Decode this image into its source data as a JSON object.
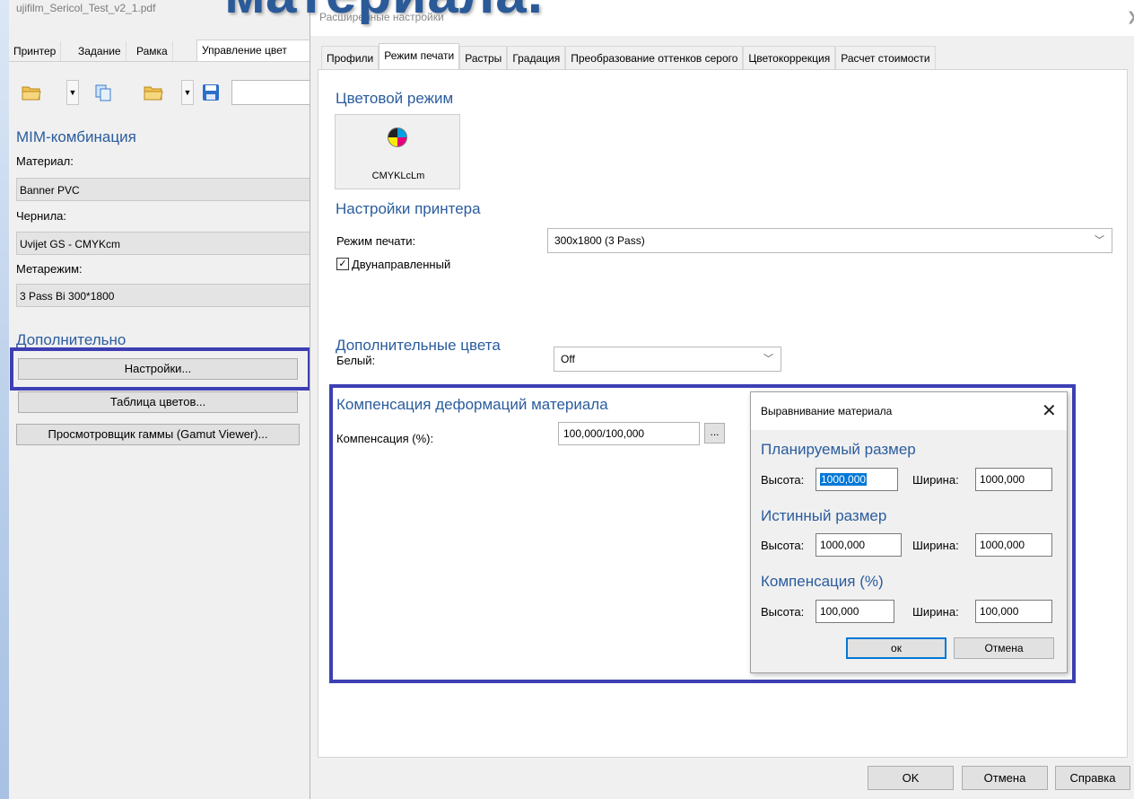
{
  "slide": {
    "heading": "материала."
  },
  "left_panel": {
    "file_title": "ujifilm_Sericol_Test_v2_1.pdf",
    "tabs": [
      "Принтер",
      "Задание",
      "Рамка",
      "Управление цвет"
    ],
    "active_tab_index": 3,
    "mim_heading": "MIM-комбинация",
    "material_label": "Материал:",
    "material_value": "Banner PVC",
    "ink_label": "Чернила:",
    "ink_value": "Uvijet GS - CMYKcm",
    "metamode_label": "Метарежим:",
    "metamode_value": "3 Pass Bi 300*1800",
    "additional_heading": "Дополнительно",
    "settings_button": "Настройки...",
    "color_table_button": "Таблица цветов...",
    "gamut_viewer_button": "Просмотровщик гаммы (Gamut Viewer)..."
  },
  "dialog": {
    "title": "Расширенные настройки",
    "tabs": [
      "Профили",
      "Режим печати",
      "Растры",
      "Градация",
      "Преобразование оттенков серого",
      "Цветокоррекция",
      "Расчет стоимости"
    ],
    "active_tab_index": 1,
    "color_mode_heading": "Цветовой режим",
    "color_mode_button": "CMYKLcLm",
    "printer_settings_heading": "Настройки принтера",
    "print_mode_label": "Режим печати:",
    "print_mode_value": "300x1800 (3 Pass)",
    "bidirectional_label": "Двунаправленный",
    "bidirectional_checked": true,
    "extra_colors_heading": "Дополнительные цвета",
    "white_label": "Белый:",
    "white_value": "Off",
    "compensation_heading": "Компенсация деформаций материала",
    "compensation_label": "Компенсация (%):",
    "compensation_value": "100,000/100,000",
    "ellipsis_button": "...",
    "ok_button": "OK",
    "cancel_button": "Отмена",
    "help_button": "Справка"
  },
  "alignment_dialog": {
    "title": "Выравнивание материала",
    "planned_heading": "Планируемый размер",
    "true_heading": "Истинный размер",
    "comp_heading": "Компенсация (%)",
    "height_label": "Высота:",
    "width_label": "Ширина:",
    "planned_height": "1000,000",
    "planned_width": "1000,000",
    "true_height": "1000,000",
    "true_width": "1000,000",
    "comp_height": "100,000",
    "comp_width": "100,000",
    "ok_button": "ок",
    "cancel_button": "Отмена"
  },
  "colors": {
    "highlight": "#3d3fb3",
    "heading_blue": "#2a5c9e",
    "selection": "#0078d7"
  }
}
